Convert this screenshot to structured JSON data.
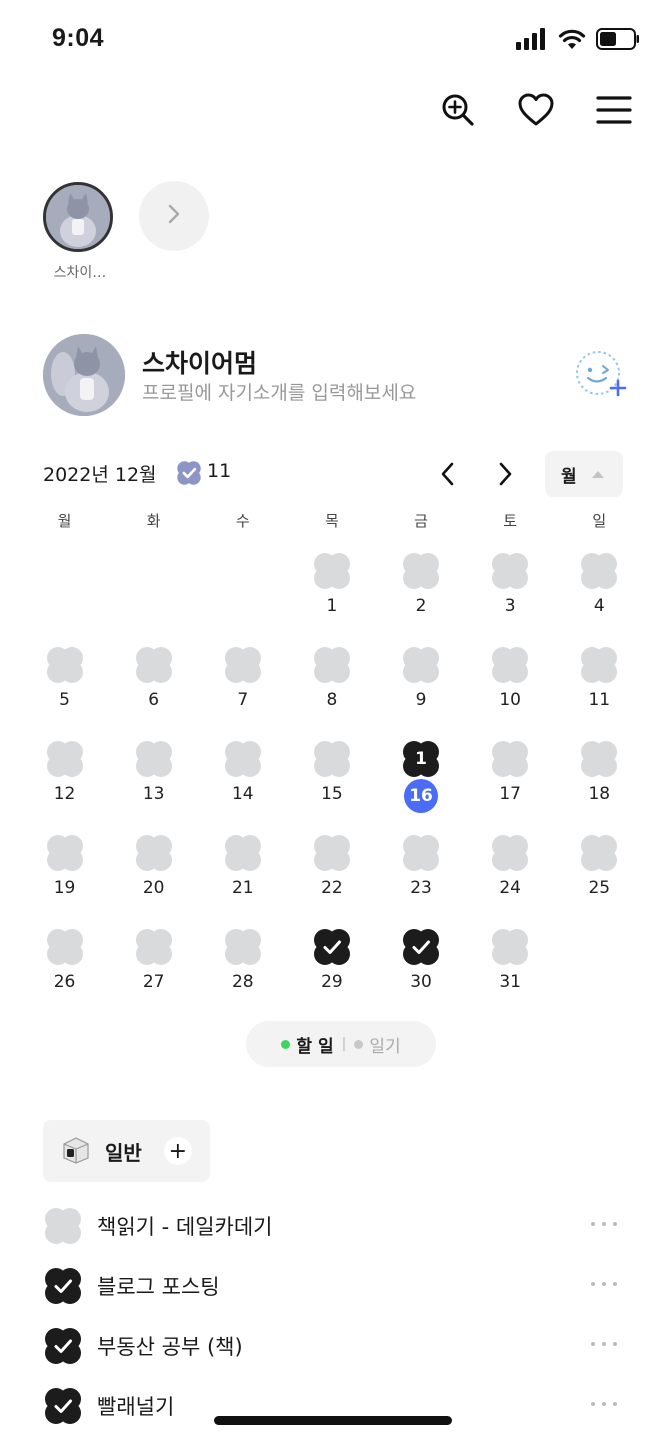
{
  "status_bar": {
    "time": "9:04",
    "icons": [
      "signal-icon",
      "wifi-icon",
      "battery-icon"
    ]
  },
  "top_bar": {
    "icons": [
      "search-add-icon",
      "heart-icon",
      "menu-icon"
    ]
  },
  "stories": {
    "user_label": "스차이…"
  },
  "profile": {
    "name": "스차이어멈",
    "bio_placeholder": "프로필에 자기소개를 입력해보세요"
  },
  "calendar": {
    "title": "2022년 12월",
    "completed_count": "11",
    "view_mode": "월",
    "weekdays": [
      "월",
      "화",
      "수",
      "목",
      "금",
      "토",
      "일"
    ],
    "weeks": [
      [
        null,
        null,
        null,
        {
          "day": "1"
        },
        {
          "day": "2"
        },
        {
          "day": "3"
        },
        {
          "day": "4"
        }
      ],
      [
        {
          "day": "5"
        },
        {
          "day": "6"
        },
        {
          "day": "7"
        },
        {
          "day": "8"
        },
        {
          "day": "9"
        },
        {
          "day": "10"
        },
        {
          "day": "11"
        }
      ],
      [
        {
          "day": "12"
        },
        {
          "day": "13"
        },
        {
          "day": "14"
        },
        {
          "day": "15"
        },
        {
          "day": "16",
          "state": "count",
          "count": "1",
          "today": true
        },
        {
          "day": "17"
        },
        {
          "day": "18"
        }
      ],
      [
        {
          "day": "19"
        },
        {
          "day": "20"
        },
        {
          "day": "21"
        },
        {
          "day": "22"
        },
        {
          "day": "23"
        },
        {
          "day": "24"
        },
        {
          "day": "25"
        }
      ],
      [
        {
          "day": "26"
        },
        {
          "day": "27"
        },
        {
          "day": "28"
        },
        {
          "day": "29",
          "state": "done"
        },
        {
          "day": "30",
          "state": "done"
        },
        {
          "day": "31"
        },
        null
      ]
    ],
    "colors": {
      "empty_clover": "#d9dadc",
      "filled_clover": "#1c1c1c",
      "today": "#4a6cf7",
      "badge": "#8d95c6"
    }
  },
  "mode_toggle": {
    "todo_label": "할 일",
    "todo_dot_color": "#3ed65a",
    "separator": "|",
    "diary_label": "일기",
    "diary_dot_color": "#c8c8c8"
  },
  "category": {
    "label": "일반",
    "add_symbol": "+"
  },
  "todos": [
    {
      "label": "책읽기 - 데일카데기",
      "done": false
    },
    {
      "label": "블로그 포스팅",
      "done": true
    },
    {
      "label": "부동산 공부 (책)",
      "done": true
    },
    {
      "label": "빨래널기",
      "done": true
    }
  ]
}
